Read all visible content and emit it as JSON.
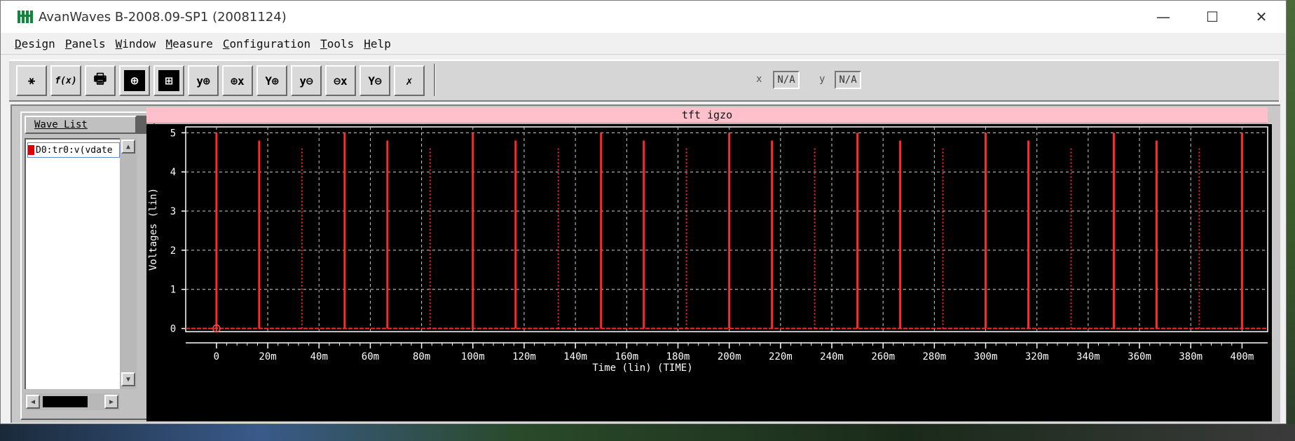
{
  "window": {
    "title": "AvanWaves B-2008.09-SP1 (20081124)",
    "minimize_glyph": "—",
    "maximize_glyph": "☐",
    "close_glyph": "✕"
  },
  "menu": [
    {
      "first": "D",
      "rest": "esign"
    },
    {
      "first": "P",
      "rest": "anels"
    },
    {
      "first": "W",
      "rest": "indow"
    },
    {
      "first": "M",
      "rest": "easure"
    },
    {
      "first": "C",
      "rest": "onfiguration"
    },
    {
      "first": "T",
      "rest": "ools"
    },
    {
      "first": "H",
      "rest": "elp"
    }
  ],
  "toolbar": {
    "tools": [
      {
        "name": "hierarchy-icon",
        "glyph": "⚹"
      },
      {
        "name": "fx-icon",
        "glyph": "f(x)"
      },
      {
        "name": "print-icon",
        "glyph": "🖶"
      },
      {
        "name": "add-panel-icon",
        "glyph": "⊕"
      },
      {
        "name": "add-panels-icon",
        "glyph": "⊞"
      },
      {
        "name": "y-zoom-in-x-icon",
        "glyph": "y⊕"
      },
      {
        "name": "x-zoom-in-icon",
        "glyph": "⊕x"
      },
      {
        "name": "y-zoom-in-icon",
        "glyph": "Y⊕"
      },
      {
        "name": "y-zoom-out-x-icon",
        "glyph": "y⊖"
      },
      {
        "name": "x-zoom-out-icon",
        "glyph": "⊖x"
      },
      {
        "name": "y-zoom-out-icon",
        "glyph": "Y⊖"
      },
      {
        "name": "zoom-fit-icon",
        "glyph": "✗"
      }
    ],
    "x_label": "x",
    "x_value": "N/A",
    "y_label": "y",
    "y_value": "N/A"
  },
  "wave_list": {
    "header": "Wave List",
    "items": [
      "D0:tr0:v(vdate"
    ],
    "scroll_up": "▲",
    "scroll_down": "▼",
    "scroll_left": "◀",
    "scroll_right": "▶"
  },
  "chart_data": {
    "type": "line",
    "title": "tft igzo",
    "xlabel": "Time (lin) (TIME)",
    "ylabel": "Voltages (lin)",
    "xlim": [
      -0.012,
      0.41
    ],
    "ylim": [
      -0.08,
      5.15
    ],
    "xticks": [
      0,
      0.02,
      0.04,
      0.06,
      0.08,
      0.1,
      0.12,
      0.14,
      0.16,
      0.18,
      0.2,
      0.22,
      0.24,
      0.26,
      0.28,
      0.3,
      0.32,
      0.34,
      0.36,
      0.38,
      0.4
    ],
    "xtick_labels": [
      "0",
      "20m",
      "40m",
      "60m",
      "80m",
      "100m",
      "120m",
      "140m",
      "160m",
      "180m",
      "200m",
      "220m",
      "240m",
      "260m",
      "280m",
      "300m",
      "320m",
      "340m",
      "360m",
      "380m",
      "400m"
    ],
    "yticks": [
      0,
      1,
      2,
      3,
      4,
      5
    ],
    "ytick_labels": [
      "0",
      "1",
      "2",
      "3",
      "4",
      "5"
    ],
    "grid": true,
    "series": [
      {
        "name": "D0:tr0:v(vdate",
        "color": "#ff2a2a",
        "baseline": 0,
        "pulses": [
          {
            "t": 0.0,
            "v": 5.0
          },
          {
            "t": 0.01667,
            "v": 4.8
          },
          {
            "t": 0.03333,
            "v": 4.6
          },
          {
            "t": 0.05,
            "v": 5.0
          },
          {
            "t": 0.06667,
            "v": 4.8
          },
          {
            "t": 0.08333,
            "v": 4.6
          },
          {
            "t": 0.1,
            "v": 5.0
          },
          {
            "t": 0.11667,
            "v": 4.8
          },
          {
            "t": 0.13333,
            "v": 4.6
          },
          {
            "t": 0.15,
            "v": 5.0
          },
          {
            "t": 0.16667,
            "v": 4.8
          },
          {
            "t": 0.18333,
            "v": 4.6
          },
          {
            "t": 0.2,
            "v": 5.0
          },
          {
            "t": 0.21667,
            "v": 4.8
          },
          {
            "t": 0.23333,
            "v": 4.6
          },
          {
            "t": 0.25,
            "v": 5.0
          },
          {
            "t": 0.26667,
            "v": 4.8
          },
          {
            "t": 0.28333,
            "v": 4.6
          },
          {
            "t": 0.3,
            "v": 5.0
          },
          {
            "t": 0.31667,
            "v": 4.8
          },
          {
            "t": 0.33333,
            "v": 4.6
          },
          {
            "t": 0.35,
            "v": 5.0
          },
          {
            "t": 0.36667,
            "v": 4.8
          },
          {
            "t": 0.38333,
            "v": 4.6
          },
          {
            "t": 0.4,
            "v": 5.0
          }
        ]
      }
    ]
  }
}
